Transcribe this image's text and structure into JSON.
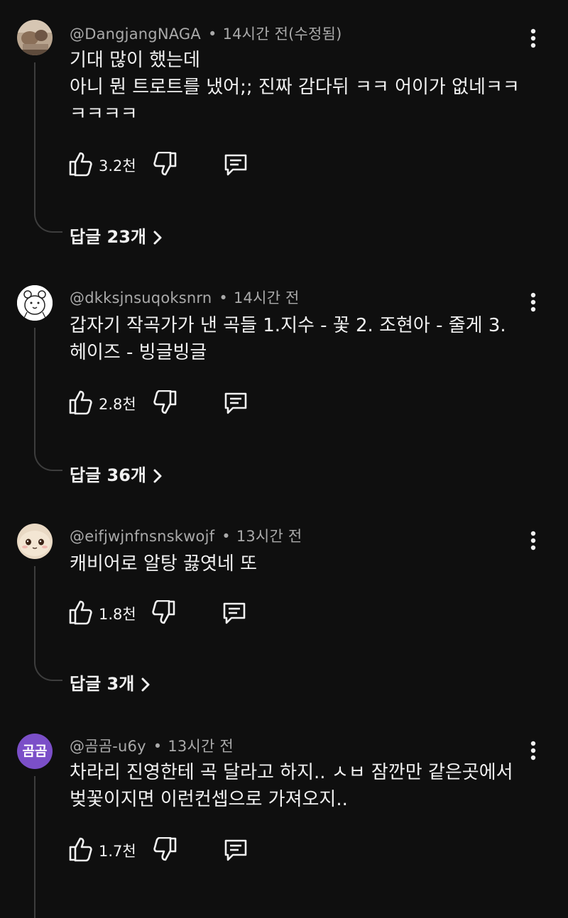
{
  "comments": [
    {
      "author": "@DangjangNAGA",
      "time": "14시간 전(수정됨)",
      "text": "기대 많이 했는데\n아니 뭔 트로트를 냈어;; 진짜 감다뒤 ㅋㅋ 어이가 없네ㅋㅋ\nㅋㅋㅋㅋ",
      "likes": "3.2천",
      "replies": "답글 23개",
      "avatar": "photo"
    },
    {
      "author": "@dkksjnsuqoksnrn",
      "time": "14시간 전",
      "text": "갑자기 작곡가가 낸 곡들 1.지수 - 꽃 2. 조현아 - 줄게 3.\n헤이즈 - 빙글빙글",
      "likes": "2.8천",
      "replies": "답글 36개",
      "avatar": "bear-drawing"
    },
    {
      "author": "@eifjwjnfnsnskwojf",
      "time": "13시간 전",
      "text": "캐비어로 알탕 끓엿네 또",
      "likes": "1.8천",
      "replies": "답글 3개",
      "avatar": "plush-face"
    },
    {
      "author": "@곰곰-u6y",
      "time": "13시간 전",
      "text": "차라리 진영한테 곡 달라고 하지.. ㅅㅂ 잠깐만 같은곳에서\n벚꽃이지면 이런컨셉으로 가져오지..",
      "likes": "1.7천",
      "avatar_text": "곰곰",
      "avatar": "letters"
    }
  ],
  "icons": {
    "like": "thumbs-up-icon",
    "dislike": "thumbs-down-icon",
    "reply": "comment-icon",
    "more": "more-vertical-icon",
    "chevron": "chevron-right-icon"
  },
  "colors": {
    "background": "#0f0f0f",
    "primary_text": "#f1f1f1",
    "secondary_text": "#aaaaaa",
    "thread_line": "#3d3d3d",
    "letter_avatar": "#7b4fc8"
  }
}
